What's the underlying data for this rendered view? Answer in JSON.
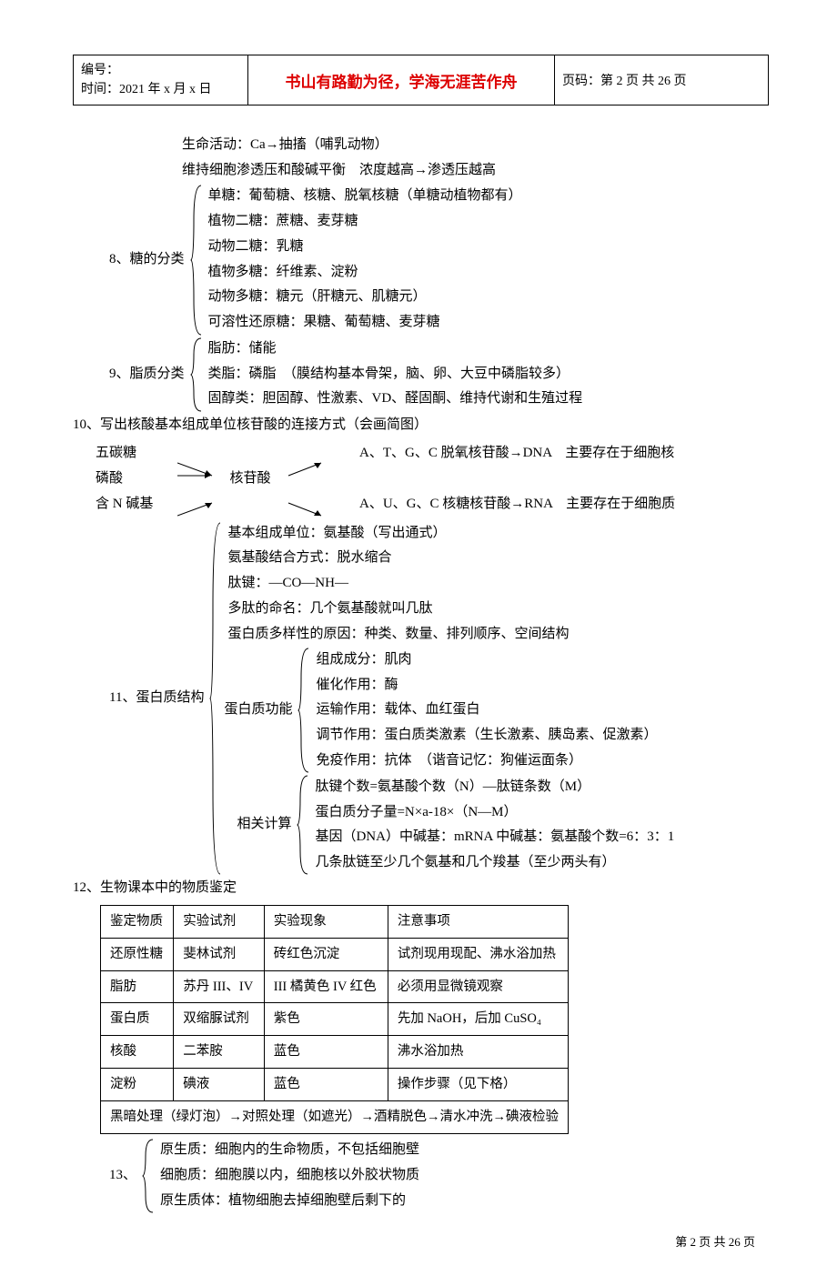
{
  "header": {
    "left_line1": "编号：",
    "left_line2": "时间：2021 年 x 月 x 日",
    "mid": "书山有路勤为径，学海无涯苦作舟",
    "right": "页码：第 2 页 共 26 页"
  },
  "pre_lines": [
    "生命活动：Ca→抽搐（哺乳动物）",
    "维持细胞渗透压和酸碱平衡　浓度越高→渗透压越高"
  ],
  "item8": {
    "label": "8、糖的分类",
    "lines": [
      "单糖：葡萄糖、核糖、脱氧核糖（单糖动植物都有）",
      "植物二糖：蔗糖、麦芽糖",
      "动物二糖：乳糖",
      "植物多糖：纤维素、淀粉",
      "动物多糖：糖元（肝糖元、肌糖元）",
      "可溶性还原糖：果糖、葡萄糖、麦芽糖"
    ]
  },
  "item9": {
    "label": "9、脂质分类",
    "lines": [
      "脂肪：储能",
      "类脂：磷脂　（膜结构基本骨架，脑、卵、大豆中磷脂较多）",
      "固醇类：胆固醇、性激素、VD、醛固酮、维持代谢和生殖过程"
    ]
  },
  "item10": {
    "title": "10、写出核酸基本组成单位核苷酸的连接方式（会画简图）",
    "left1": "五碳糖",
    "left2": "磷酸",
    "left3": "含 N 碱基",
    "mid": "核苷酸",
    "right1": "A、T、G、C 脱氧核苷酸→DNA　主要存在于细胞核",
    "right2": "A、U、G、C 核糖核苷酸→RNA　主要存在于细胞质"
  },
  "item11": {
    "label": "11、蛋白质结构",
    "top_lines": [
      "基本组成单位：氨基酸（写出通式）",
      "氨基酸结合方式：脱水缩合",
      "肽键：—CO—NH—",
      "多肽的命名：几个氨基酸就叫几肽",
      "蛋白质多样性的原因：种类、数量、排列顺序、空间结构"
    ],
    "func_label": "蛋白质功能",
    "func_lines": [
      "组成成分：肌肉",
      "催化作用：酶",
      "运输作用：载体、血红蛋白",
      "调节作用：蛋白质类激素（生长激素、胰岛素、促激素）",
      "免疫作用：抗体　（谐音记忆：狗催运面条）"
    ],
    "calc_label": "相关计算",
    "calc_lines": [
      "肽键个数=氨基酸个数（N）—肽链条数（M）",
      "蛋白质分子量=N×a-18×（N—M）",
      "基因（DNA）中碱基：mRNA 中碱基：氨基酸个数=6：3：1",
      "几条肽链至少几个氨基和几个羧基（至少两头有）"
    ]
  },
  "item12": {
    "title": "12、生物课本中的物质鉴定",
    "headers": [
      "鉴定物质",
      "实验试剂",
      "实验现象",
      "注意事项"
    ],
    "rows": [
      [
        "还原性糖",
        "斐林试剂",
        "砖红色沉淀",
        "试剂现用现配、沸水浴加热"
      ],
      [
        "脂肪",
        "苏丹 III、IV",
        "III 橘黄色 IV 红色",
        "必须用显微镜观察"
      ],
      [
        "蛋白质",
        "双缩脲试剂",
        "紫色",
        "先加 NaOH，后加 CuSO₄"
      ],
      [
        "核酸",
        "二苯胺",
        "蓝色",
        "沸水浴加热"
      ],
      [
        "淀粉",
        "碘液",
        "蓝色",
        "操作步骤（见下格）"
      ]
    ],
    "bottom_row": "黑暗处理（绿灯泡）→对照处理（如遮光）→酒精脱色→清水冲洗→碘液检验"
  },
  "item13": {
    "label": "13、",
    "lines": [
      "原生质：细胞内的生命物质，不包括细胞壁",
      "细胞质：细胞膜以内，细胞核以外胶状物质",
      "原生质体：植物细胞去掉细胞壁后剩下的"
    ]
  },
  "footer": "第 2 页 共 26 页"
}
